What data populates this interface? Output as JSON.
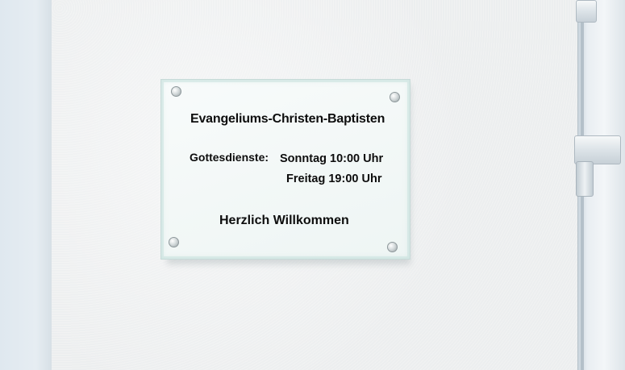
{
  "sign": {
    "title": "Evangeliums-Christen-Baptisten",
    "services_label": "Gottesdienste:",
    "service_times": [
      "Sonntag 10:00 Uhr",
      "Freitag 19:00 Uhr"
    ],
    "welcome": "Herzlich Willkommen"
  },
  "colors": {
    "wall": "#eeefef",
    "sign_glass": "#f3f8f7",
    "text": "#0d0d0d",
    "door_frame": "#e9eef2"
  }
}
